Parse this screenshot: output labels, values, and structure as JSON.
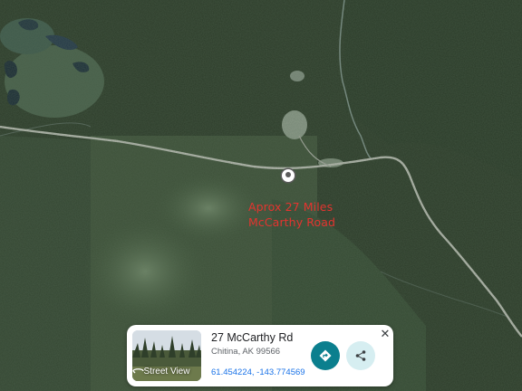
{
  "map": {
    "layer": "satellite",
    "annotation": {
      "line1": "Aprox 27 Miles",
      "line2": "McCarthy Road",
      "color": "#e3342f"
    },
    "marker": "location-pin-icon"
  },
  "place_card": {
    "title": "27 McCarthy Rd",
    "address": "Chitina, AK 99566",
    "coordinates": "61.454224, -143.774569",
    "street_view_label": "Street View",
    "directions_icon": "directions-icon",
    "share_icon": "share-icon",
    "close_icon": "close-icon",
    "accent_color": "#0b7f8e"
  }
}
